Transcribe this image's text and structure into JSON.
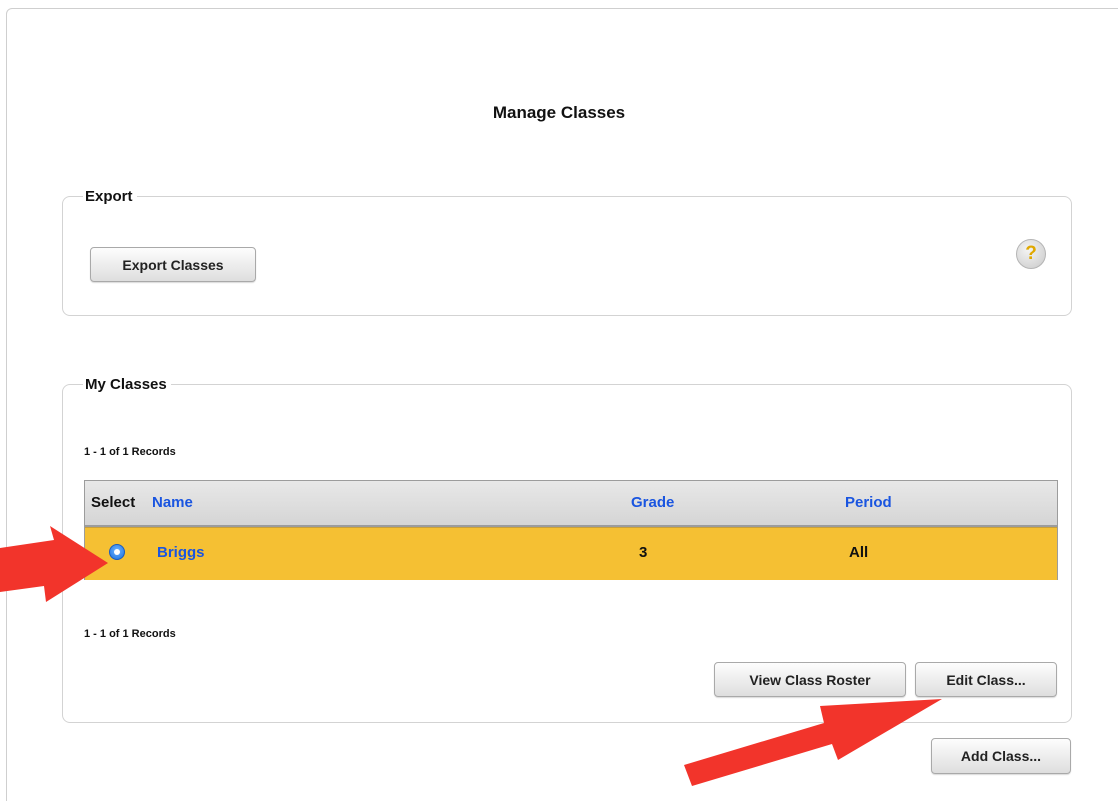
{
  "page": {
    "title": "Manage Classes"
  },
  "export_section": {
    "legend": "Export",
    "export_button_label": "Export Classes",
    "help_icon_glyph": "?",
    "help_icon_name": "help-icon"
  },
  "classes_section": {
    "legend": "My Classes",
    "records_top": "1 - 1 of 1 Records",
    "records_bottom": "1 - 1 of 1 Records",
    "columns": {
      "select": "Select",
      "name": "Name",
      "grade": "Grade",
      "period": "Period"
    },
    "rows": [
      {
        "selected": true,
        "name": "Briggs",
        "grade": "3",
        "period": "All"
      }
    ],
    "view_roster_label": "View Class Roster",
    "edit_class_label": "Edit Class..."
  },
  "add_class_label": "Add Class...",
  "colors": {
    "link_blue": "#1a55e0",
    "selected_row": "#f5c033",
    "arrow_red": "#f2342b",
    "help_question": "#e0a800"
  }
}
